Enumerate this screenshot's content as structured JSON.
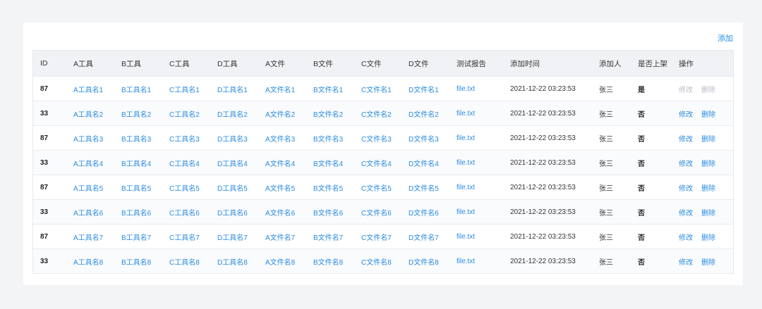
{
  "toolbar": {
    "add_label": "添加"
  },
  "columns": [
    {
      "key": "id",
      "label": "ID"
    },
    {
      "key": "toolA",
      "label": "A工具"
    },
    {
      "key": "toolB",
      "label": "B工具"
    },
    {
      "key": "toolC",
      "label": "C工具"
    },
    {
      "key": "toolD",
      "label": "D工具"
    },
    {
      "key": "fileA",
      "label": "A文件"
    },
    {
      "key": "fileB",
      "label": "B文件"
    },
    {
      "key": "fileC",
      "label": "C文件"
    },
    {
      "key": "fileD",
      "label": "D文件"
    },
    {
      "key": "report",
      "label": "测试报告"
    },
    {
      "key": "time",
      "label": "添加时间"
    },
    {
      "key": "adder",
      "label": "添加人"
    },
    {
      "key": "listed",
      "label": "是否上架"
    },
    {
      "key": "ops",
      "label": "操作"
    }
  ],
  "actions": {
    "edit": "修改",
    "delete": "删除"
  },
  "rows": [
    {
      "id": "87",
      "toolA": "A工具名1",
      "toolB": "B工具名1",
      "toolC": "C工具名1",
      "toolD": "D工具名1",
      "fileA": "A文件名1",
      "fileB": "B文件名1",
      "fileC": "C文件名1",
      "fileD": "D文件名1",
      "report": "file.txt",
      "time": "2021-12-22 03:23:53",
      "adder": "张三",
      "listed": "是",
      "ops_disabled": true
    },
    {
      "id": "33",
      "toolA": "A工具名2",
      "toolB": "B工具名2",
      "toolC": "C工具名2",
      "toolD": "D工具名2",
      "fileA": "A文件名2",
      "fileB": "B文件名2",
      "fileC": "C文件名2",
      "fileD": "D文件名2",
      "report": "file.txt",
      "time": "2021-12-22 03:23:53",
      "adder": "张三",
      "listed": "否",
      "ops_disabled": false
    },
    {
      "id": "87",
      "toolA": "A工具名3",
      "toolB": "B工具名3",
      "toolC": "C工具名3",
      "toolD": "D工具名3",
      "fileA": "A文件名3",
      "fileB": "B文件名3",
      "fileC": "C文件名3",
      "fileD": "D文件名3",
      "report": "file.txt",
      "time": "2021-12-22 03:23:53",
      "adder": "张三",
      "listed": "否",
      "ops_disabled": false
    },
    {
      "id": "33",
      "toolA": "A工具名4",
      "toolB": "B工具名4",
      "toolC": "C工具名4",
      "toolD": "D工具名4",
      "fileA": "A文件名4",
      "fileB": "B文件名4",
      "fileC": "C文件名4",
      "fileD": "D文件名4",
      "report": "file.txt",
      "time": "2021-12-22 03:23:53",
      "adder": "张三",
      "listed": "否",
      "ops_disabled": false
    },
    {
      "id": "87",
      "toolA": "A工具名5",
      "toolB": "B工具名5",
      "toolC": "C工具名5",
      "toolD": "D工具名5",
      "fileA": "A文件名5",
      "fileB": "B文件名5",
      "fileC": "C文件名5",
      "fileD": "D文件名5",
      "report": "file.txt",
      "time": "2021-12-22 03:23:53",
      "adder": "张三",
      "listed": "否",
      "ops_disabled": false
    },
    {
      "id": "33",
      "toolA": "A工具名6",
      "toolB": "B工具名6",
      "toolC": "C工具名6",
      "toolD": "D工具名6",
      "fileA": "A文件名6",
      "fileB": "B文件名6",
      "fileC": "C文件名6",
      "fileD": "D文件名6",
      "report": "file.txt",
      "time": "2021-12-22 03:23:53",
      "adder": "张三",
      "listed": "否",
      "ops_disabled": false
    },
    {
      "id": "87",
      "toolA": "A工具名7",
      "toolB": "B工具名7",
      "toolC": "C工具名7",
      "toolD": "D工具名7",
      "fileA": "A文件名7",
      "fileB": "B文件名7",
      "fileC": "C文件名7",
      "fileD": "D文件名7",
      "report": "file.txt",
      "time": "2021-12-22 03:23:53",
      "adder": "张三",
      "listed": "否",
      "ops_disabled": false
    },
    {
      "id": "33",
      "toolA": "A工具名8",
      "toolB": "B工具名8",
      "toolC": "C工具名8",
      "toolD": "D工具名8",
      "fileA": "A文件名8",
      "fileB": "B文件名8",
      "fileC": "C文件名8",
      "fileD": "D文件名8",
      "report": "file.txt",
      "time": "2021-12-22 03:23:53",
      "adder": "张三",
      "listed": "否",
      "ops_disabled": false
    }
  ]
}
